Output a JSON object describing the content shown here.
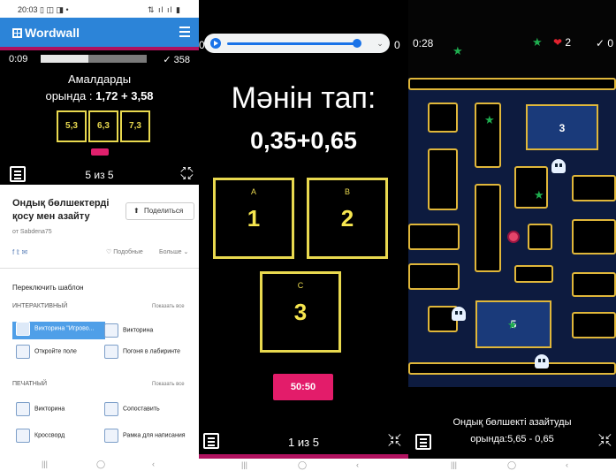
{
  "panel1": {
    "status_time": "20:03",
    "status_icons": "▯ ◫ ◨ •",
    "status_right": "⇅ ıl ıl ▮",
    "app_name": "Wordwall",
    "game_timer": "0:09",
    "progress": 0.45,
    "score": "358",
    "question_line1": "Амалдарды",
    "question_line2_prefix": "орында : ",
    "question_expr": "1,72 + 3,58",
    "answers": [
      "5,3",
      "6,3",
      "7,3"
    ],
    "counter": "5 из 5",
    "activity_title": "Ондық бөлшектерді қосу мен азайту",
    "share_label": "Поделиться",
    "author": "от  Sabdena75",
    "likes_label": "♡ Подобные",
    "more_label": "Больше ⌄",
    "switch_template": "Переключить шаблон",
    "interactive_heading": "ИНТЕРАКТИВНЫЙ",
    "show_all": "Показать все",
    "interactive_templates": [
      "Викторина \"Игрово...",
      "Викторина",
      "Откройте поле",
      "Погоня в лабиринте"
    ],
    "print_heading": "ПЕЧАТНЫЙ",
    "print_templates": [
      "Викторина",
      "Сопоставить",
      "Кроссворд",
      "Рамка для написания"
    ]
  },
  "panel2": {
    "timer": "0:",
    "score": "0",
    "audio_progress": 0.92,
    "question_line1": "Мәнін тап:",
    "question_expr": "0,35+0,65",
    "answer_letters": [
      "A",
      "B",
      "C"
    ],
    "answer_values": [
      "1",
      "2",
      "3"
    ],
    "fifty_label": "50:50",
    "counter": "1 из 5"
  },
  "panel3": {
    "timer": "0:28",
    "lives": "2",
    "score": "0",
    "zone_numbers": [
      "3",
      "5"
    ],
    "prompt_line1": "Ондық бөлшекті азайтуды",
    "prompt_line2": "орында:5,65 - 0,65"
  },
  "navbar": {
    "recents": "|||",
    "home": "◯",
    "back": "‹"
  },
  "colors": {
    "brand_blue": "#2c84d8",
    "accent_magenta": "#b0125f",
    "answer_yellow": "#e9d94f",
    "fifty_pink": "#e31c6a"
  }
}
